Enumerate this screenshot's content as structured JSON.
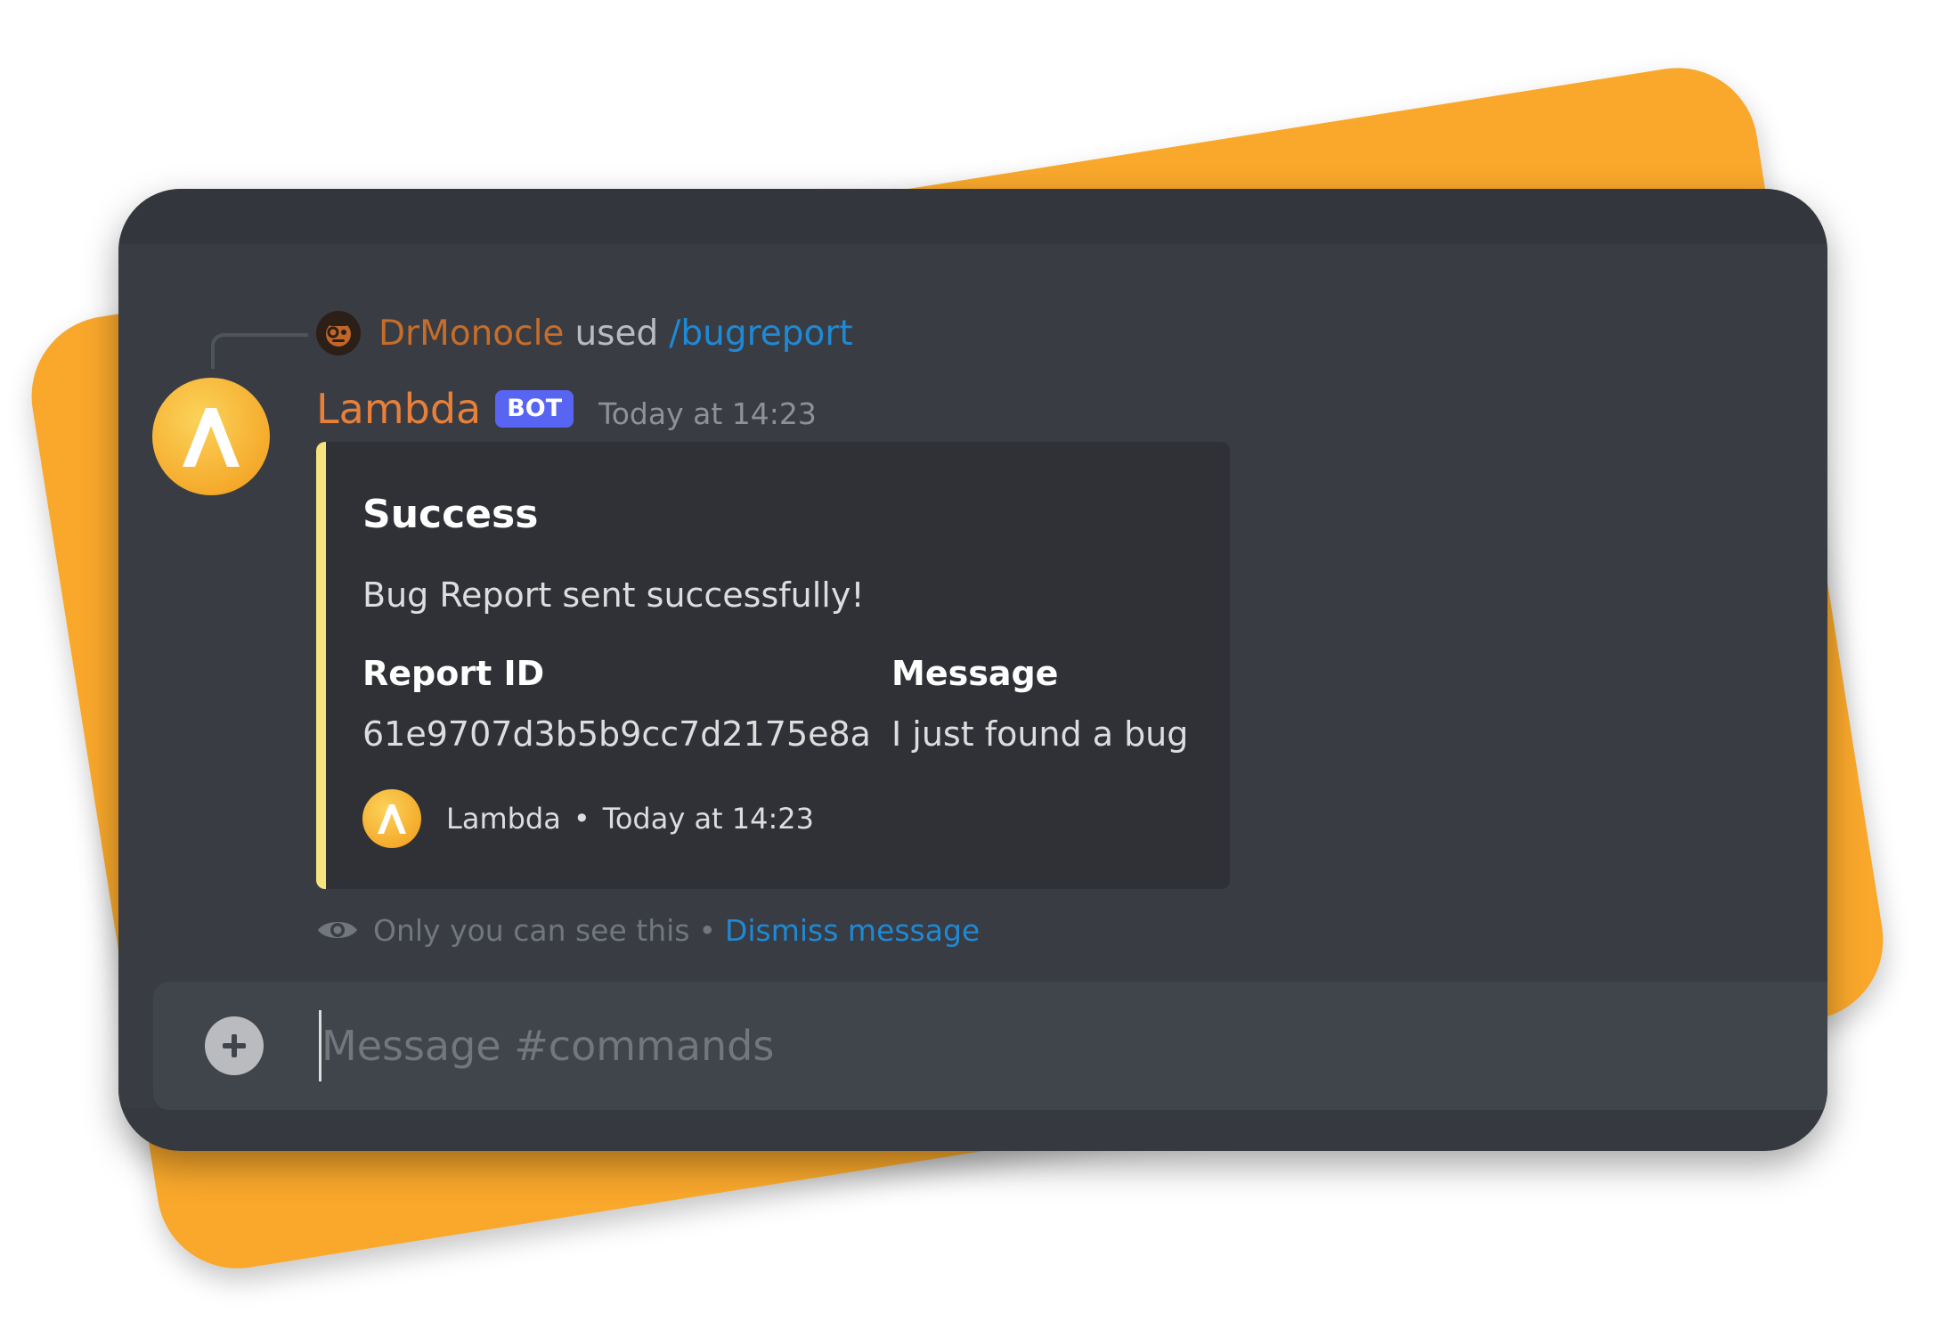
{
  "reply": {
    "user": "DrMonocle",
    "used_text": "used",
    "command": "/bugreport"
  },
  "message": {
    "author": "Lambda",
    "bot_tag": "BOT",
    "timestamp": "Today at 14:23"
  },
  "embed": {
    "accent_color": "#f6e27f",
    "title": "Success",
    "description": "Bug Report sent successfully!",
    "fields": [
      {
        "name": "Report ID",
        "value": "61e9707d3b5b9cc7d2175e8a"
      },
      {
        "name": "Message",
        "value": "I just found a bug"
      }
    ],
    "footer": {
      "author": "Lambda",
      "separator": "•",
      "timestamp": "Today at 14:23"
    }
  },
  "ephemeral": {
    "icon": "eye-icon",
    "text": "Only you can see this",
    "separator": "•",
    "dismiss_label": "Dismiss message"
  },
  "composer": {
    "add_icon": "plus-circle-icon",
    "placeholder": "Message #commands"
  },
  "colors": {
    "backdrop": "#f9a82b",
    "window_bg": "#36393f",
    "author": "#e8803a",
    "link": "#1e8ad6",
    "bot_tag": "#5865f2"
  }
}
